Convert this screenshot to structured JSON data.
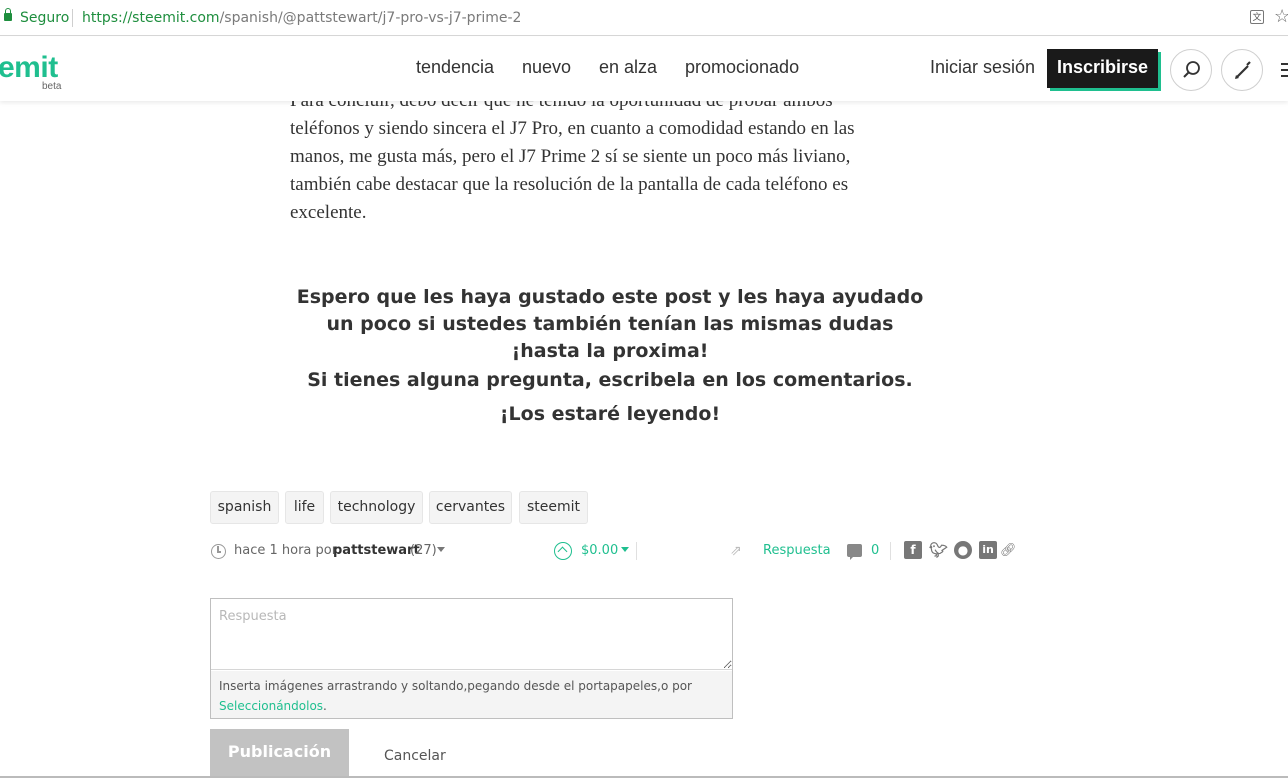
{
  "browser": {
    "secure_label": "Seguro",
    "url_host": "https://steemit.com",
    "url_path": "/spanish/@pattstewart/j7-pro-vs-j7-prime-2",
    "translate_icon": "translate-icon",
    "bookmark_icon": "star-icon"
  },
  "header": {
    "logo": "emit",
    "beta": "beta",
    "nav": [
      "tendencia",
      "nuevo",
      "en alza",
      "promocionado"
    ],
    "login": "Iniciar sesión",
    "signup": "Inscribirse",
    "accent_color": "#1fbf8f"
  },
  "article": {
    "paragraph_cut": "Para concluir, debo decir que he tenido la oportunidad de probar ambos",
    "paragraph_lines": [
      "teléfonos y siendo sincera el J7 Pro, en cuanto a comodidad estando en las",
      "manos, me gusta más, pero el J7 Prime 2 sí se siente un poco más liviano,",
      "también cabe destacar que la resolución de la pantalla de cada teléfono es",
      "excelente."
    ],
    "closing_1": "Espero que les haya gustado este post y les haya ayudado un poco si ustedes también tenían las mismas dudas ¡hasta la proxima!",
    "closing_2": "Si tienes alguna pregunta, escribela en los comentarios. ¡Los estaré leyendo!"
  },
  "tags": [
    "spanish",
    "life",
    "technology",
    "cervantes",
    "steemit"
  ],
  "meta": {
    "time": "hace 1 hora por",
    "author": "pattstewart",
    "reputation": "(27)",
    "payout": "$0.00",
    "reply": "Respuesta",
    "comments": "0"
  },
  "editor": {
    "placeholder": "Respuesta",
    "hint": "Inserta imágenes arrastrando y soltando,pegando desde el portapapeles,o por",
    "select_link": "Seleccionándolos",
    "hint_end": ".",
    "publish": "Publicación",
    "cancel": "Cancelar"
  }
}
